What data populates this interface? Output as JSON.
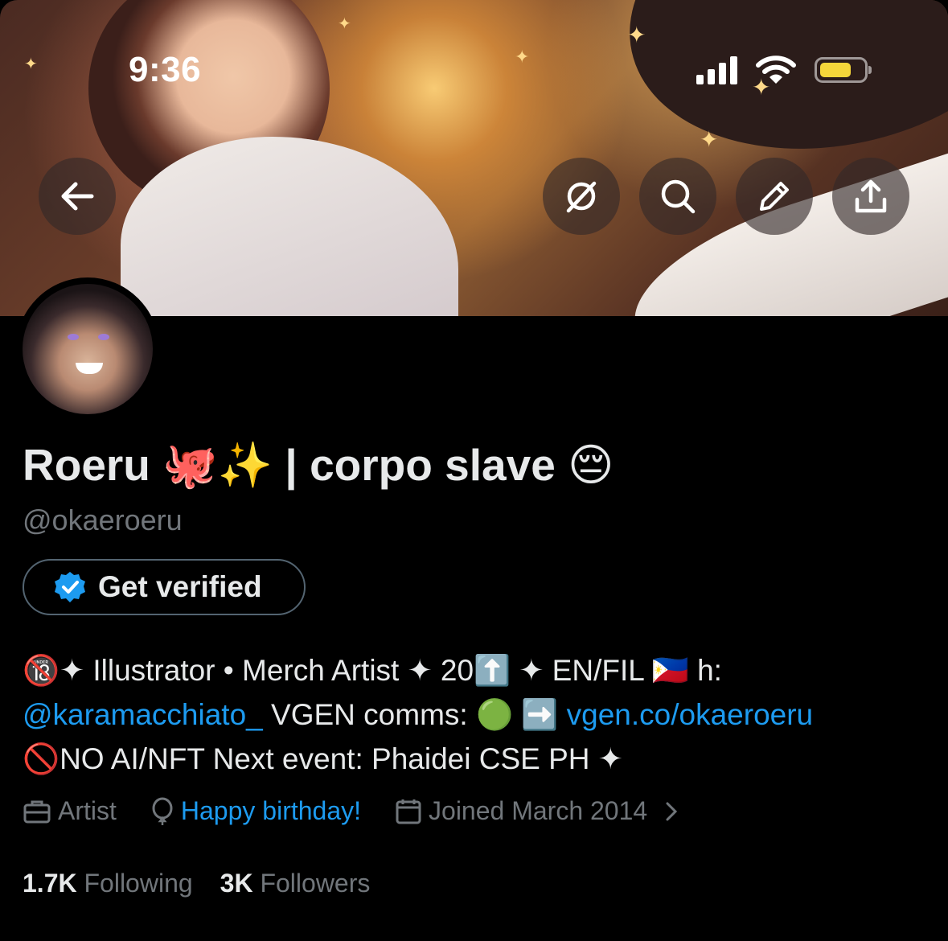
{
  "status_bar": {
    "time": "9:36"
  },
  "banner_buttons": [
    "back-icon",
    "no-sync-icon",
    "search-icon",
    "edit-icon",
    "share-icon"
  ],
  "profile": {
    "display_name": "Roeru 🐙✨ | corpo slave 😔",
    "handle": "@okaeroeru",
    "verify_button": "Get verified",
    "bio": {
      "line1": "🔞✦ Illustrator • Merch Artist ✦ 20⬆️ ✦ EN/FIL 🇵🇭  h:",
      "mention": "@karamacchiato_",
      "line2_text": " VGEN comms: 🟢 ➡️ ",
      "link": "vgen.co/okaeroeru",
      "line3": "🚫NO AI/NFT Next event: Phaidei CSE PH ✦"
    },
    "meta": {
      "category": "Artist",
      "birthday": "Happy birthday!",
      "joined": "Joined March 2014"
    },
    "stats": {
      "following_count": "1.7K",
      "following_label": "Following",
      "followers_count": "3K",
      "followers_label": "Followers"
    }
  },
  "colors": {
    "accent": "#1d9bf0",
    "muted": "#71767b",
    "text": "#e7e9ea",
    "background": "#000000",
    "battery": "#f5d63a"
  }
}
